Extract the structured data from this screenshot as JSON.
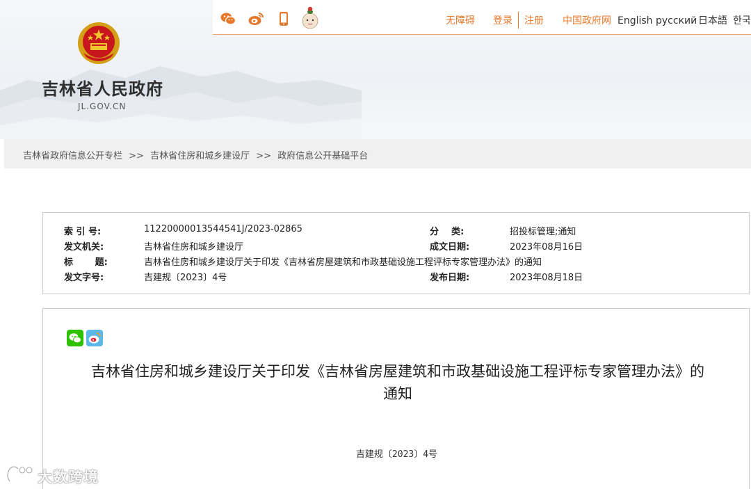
{
  "site": {
    "title": "吉林省人民政府",
    "domain": "JL.GOV.CN"
  },
  "topbar": {
    "social_icons": [
      "wechat-icon",
      "weibo-icon",
      "mobile-icon",
      "mascot-icon"
    ],
    "accessibility": "无障碍",
    "login": "登录",
    "register": "注册",
    "gov_portal": "中国政府网",
    "lang_en": "English",
    "lang_ru": "русский",
    "lang_ja": "日本語",
    "lang_ko": "한국"
  },
  "breadcrumb": {
    "items": [
      "吉林省政府信息公开专栏",
      "吉林省住房和城乡建设厅",
      "政府信息公开基础平台"
    ],
    "separator": ">>"
  },
  "meta": {
    "index_label": "索 引 号:",
    "index_value": "11220000013544541J/2023-02865",
    "category_label": "分    类:",
    "category_value": "招投标管理;通知",
    "issuer_label": "发文机关:",
    "issuer_value": "吉林省住房和城乡建设厅",
    "written_label": "成文日期:",
    "written_value": "2023年08月16日",
    "title_label": "标       题:",
    "title_value": "吉林省住房和城乡建设厅关于印发《吉林省房屋建筑和市政基础设施工程评标专家管理办法》的通知",
    "docno_label": "发文字号:",
    "docno_value": "吉建规〔2023〕4号",
    "published_label": "发布日期:",
    "published_value": "2023年08月18日"
  },
  "content": {
    "share_icons": [
      "wechat-share-icon",
      "weibo-share-icon"
    ],
    "title_line1": "吉林省住房和城乡建设厅关于印发《吉林省房屋建筑和市政基础设施工程评标专家管理办法》的",
    "title_line2": "通知",
    "doc_number": "吉建规〔2023〕4号"
  },
  "watermark": {
    "text": "大数跨境"
  },
  "colors": {
    "accent": "#e57a2d",
    "text": "#222222",
    "breadcrumb_bg": "#f0f0f0",
    "border": "#c9c9c9"
  }
}
